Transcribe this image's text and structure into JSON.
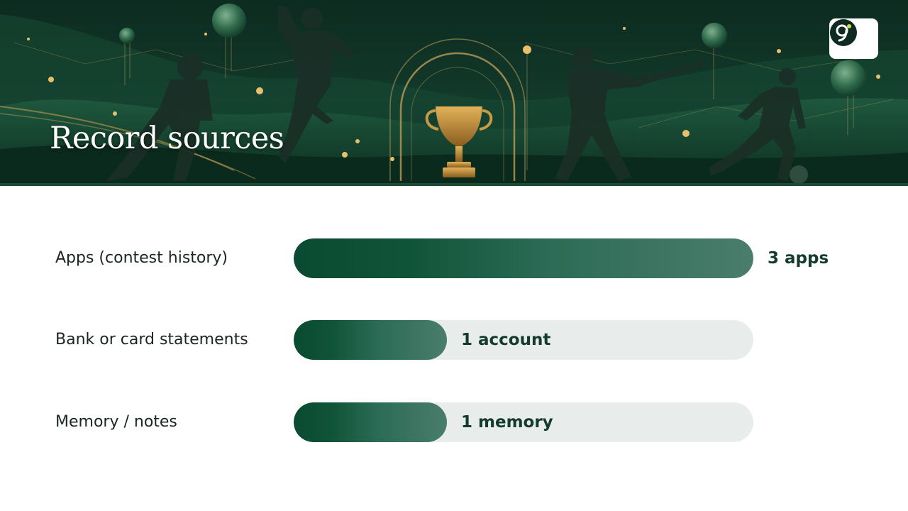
{
  "header": {
    "title": "Record sources"
  },
  "chart_data": {
    "type": "bar",
    "orientation": "horizontal",
    "categories": [
      "Apps (contest history)",
      "Bank or card statements",
      "Memory / notes"
    ],
    "values": [
      3,
      1,
      1
    ],
    "value_labels": [
      "3 apps",
      "1 account",
      "1 memory"
    ],
    "xlim": [
      0,
      3
    ],
    "grid": false,
    "legend": "none",
    "colors": {
      "bar_start": "#0a4a32",
      "bar_end": "#4a7d6c",
      "track": "#e8edeb",
      "label_text": "#1b2622",
      "value_text": "#143b2d"
    }
  }
}
